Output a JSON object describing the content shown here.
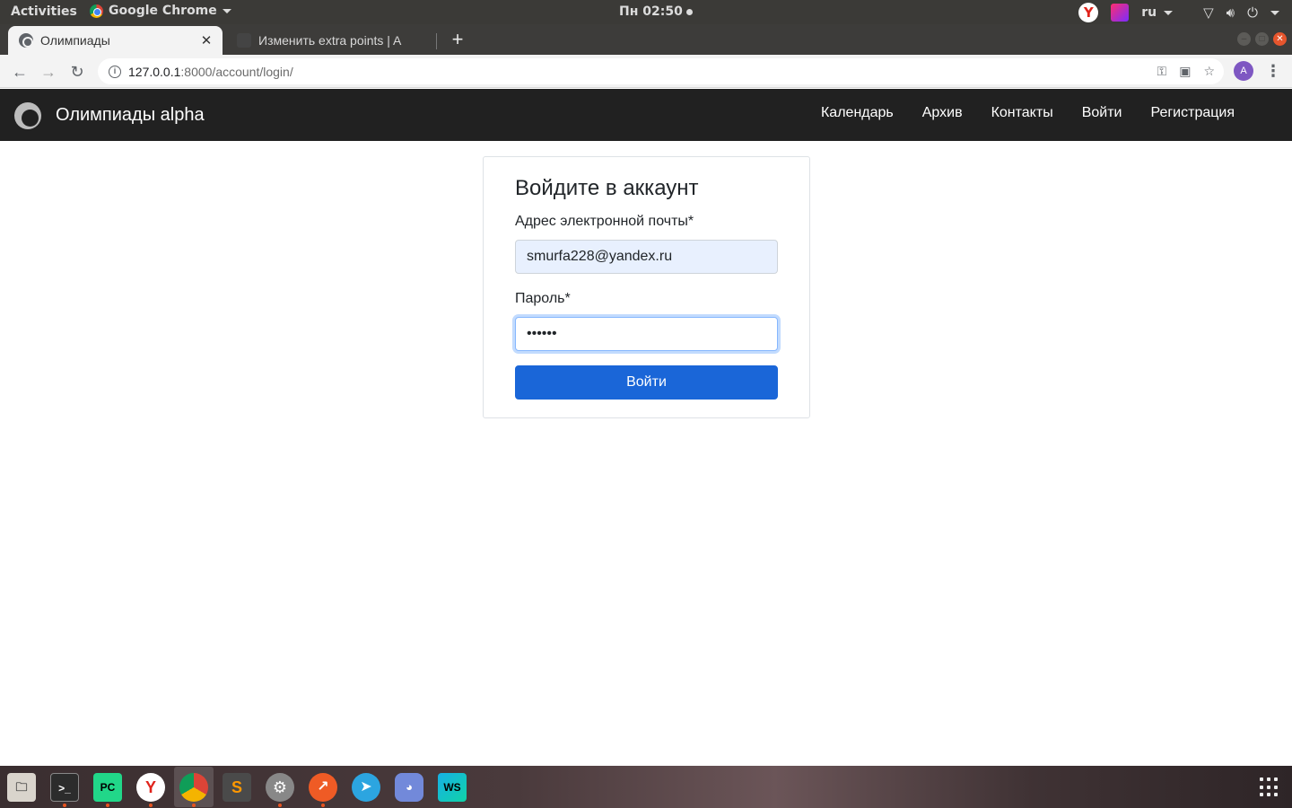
{
  "os_topbar": {
    "activities": "Activities",
    "app_name": "Google Chrome",
    "clock": "Пн 02:50",
    "language": "ru"
  },
  "browser": {
    "tabs": [
      {
        "title": "Олимпиады",
        "active": true
      },
      {
        "title": "Изменить extra points | A",
        "active": false
      }
    ],
    "url_host": "127.0.0.1",
    "url_rest": ":8000/account/login/",
    "profile_initial": "A"
  },
  "site": {
    "brand": "Олимпиады alpha",
    "nav": [
      "Календарь",
      "Архив",
      "Контакты",
      "Войти",
      "Регистрация"
    ]
  },
  "login": {
    "title": "Войдите в аккаунт",
    "email_label": "Адрес электронной почты*",
    "email_value": "smurfa228@yandex.ru",
    "password_label": "Пароль*",
    "password_value": "••••••",
    "submit_label": "Войти"
  },
  "dock": {
    "apps": [
      "files",
      "terminal",
      "pycharm",
      "yandex-browser",
      "chrome",
      "sublime-text",
      "settings",
      "postman",
      "telegram",
      "discord",
      "webstorm"
    ]
  },
  "colors": {
    "navbar_bg": "#212121",
    "primary_button": "#1a66d8",
    "autofill_bg": "#e8f0fe"
  }
}
